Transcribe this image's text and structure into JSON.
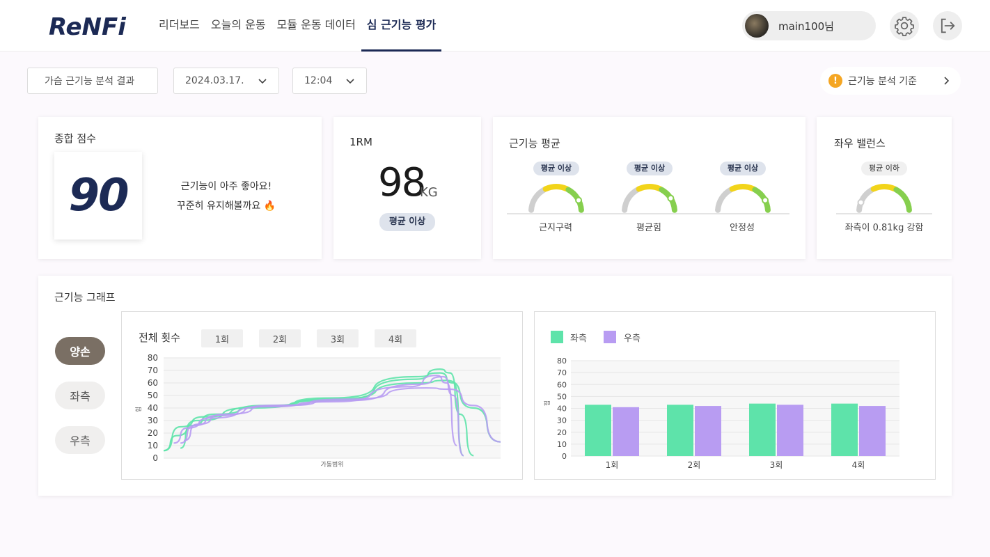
{
  "brand": {
    "logo_text": "ReNFit"
  },
  "nav": [
    {
      "label": "리더보드"
    },
    {
      "label": "오늘의 운동"
    },
    {
      "label": "모듈 운동 데이터"
    },
    {
      "label": "심 근기능 평가"
    }
  ],
  "user": {
    "name": "main100님"
  },
  "icons": {
    "settings": "gear-icon",
    "logout": "logout-icon",
    "warning": "warning-icon"
  },
  "filters": {
    "analysis": "가슴 근기능 분석 결과",
    "date": "2024.03.17.",
    "time": "12:04"
  },
  "criteria": {
    "label": "근기능 분석 기준",
    "icon_text": "!"
  },
  "score_card": {
    "title": "종합 점수",
    "score": "90",
    "message_line1": "근기능이 아주 좋아요!",
    "message_line2": "꾸준히 유지해볼까요 🔥"
  },
  "rm_card": {
    "title": "1RM",
    "value": "98",
    "unit": "KG",
    "badge": "평균 이상"
  },
  "avg_card": {
    "title": "근기능 평균",
    "gauges": [
      {
        "badge": "평균 이상",
        "label": "근지구력",
        "level": 0.85
      },
      {
        "badge": "평균 이상",
        "label": "평균힘",
        "level": 0.82
      },
      {
        "badge": "평균 이상",
        "label": "안정성",
        "level": 0.85
      }
    ]
  },
  "balance_card": {
    "title": "좌우 밸런스",
    "badge": "평균 이하",
    "label": "좌측이 0.81kg 강함",
    "level": 0.12
  },
  "graph_card": {
    "title": "근기능 그래프",
    "modes": [
      {
        "label": "양손"
      },
      {
        "label": "좌측"
      },
      {
        "label": "우측"
      }
    ],
    "active_mode": "양손"
  },
  "colors": {
    "accent": "#1c2a55",
    "left": "#5ee3aa",
    "right": "#b89cf2",
    "gauge_yellow": "#f2d41a",
    "gauge_green": "#86cf4e",
    "gauge_gray": "#cfcfcf"
  },
  "chart_data": [
    {
      "type": "line",
      "title": "전체 횟수",
      "reps": [
        "1회",
        "2회",
        "3회",
        "4회"
      ],
      "xlabel": "가동범위",
      "ylabel": "힘",
      "ylim": [
        0,
        80
      ],
      "yticks": [
        0,
        10,
        20,
        30,
        40,
        50,
        60,
        70,
        80
      ],
      "grid": true,
      "series": [
        {
          "color": "#5ee3aa",
          "x": [
            0,
            0.04,
            0.1,
            0.25,
            0.5,
            0.75,
            0.82,
            0.85,
            0.88,
            0.92
          ],
          "y": [
            6,
            18,
            30,
            40,
            46,
            63,
            71,
            68,
            35,
            2
          ]
        },
        {
          "color": "#5ee3aa",
          "x": [
            0,
            0.05,
            0.12,
            0.28,
            0.5,
            0.75,
            0.82,
            0.86,
            0.89
          ],
          "y": [
            6,
            25,
            33,
            41,
            48,
            65,
            68,
            60,
            2
          ]
        },
        {
          "color": "#5ee3aa",
          "x": [
            0.05,
            0.08,
            0.15,
            0.3,
            0.5,
            0.76,
            0.84,
            0.92,
            1.0
          ],
          "y": [
            8,
            26,
            35,
            42,
            47,
            60,
            62,
            40,
            13
          ]
        },
        {
          "color": "#b89cf2",
          "x": [
            0.03,
            0.07,
            0.14,
            0.3,
            0.5,
            0.73,
            0.81,
            0.84,
            0.87
          ],
          "y": [
            12,
            24,
            32,
            41,
            45,
            57,
            66,
            60,
            10
          ]
        },
        {
          "color": "#b89cf2",
          "x": [
            0.05,
            0.09,
            0.16,
            0.32,
            0.55,
            0.78,
            0.85,
            0.92,
            1.0
          ],
          "y": [
            12,
            26,
            34,
            42,
            47,
            56,
            55,
            42,
            13
          ]
        },
        {
          "color": "#b89cf2",
          "x": [
            0.06,
            0.1,
            0.18,
            0.34,
            0.55,
            0.76,
            0.83,
            0.86,
            0.89
          ],
          "y": [
            14,
            27,
            35,
            42,
            46,
            59,
            65,
            50,
            2
          ]
        }
      ]
    },
    {
      "type": "bar",
      "categories": [
        "1회",
        "2회",
        "3회",
        "4회"
      ],
      "series": [
        {
          "name": "좌측",
          "color": "#5ee3aa",
          "values": [
            43,
            43,
            44,
            44
          ]
        },
        {
          "name": "우측",
          "color": "#b89cf2",
          "values": [
            41,
            42,
            43,
            42
          ]
        }
      ],
      "ylabel": "힘",
      "ylim": [
        0,
        80
      ],
      "yticks": [
        0,
        10,
        20,
        30,
        40,
        50,
        60,
        70,
        80
      ],
      "grid": true,
      "legend": "top-left"
    }
  ]
}
